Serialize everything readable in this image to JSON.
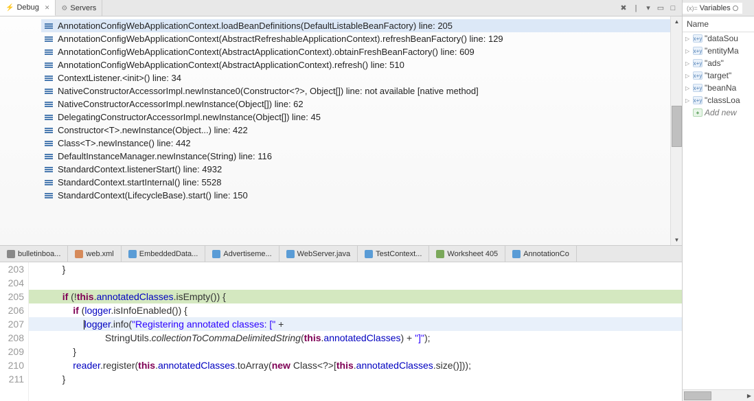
{
  "debugView": {
    "tabs": [
      {
        "label": "Debug",
        "active": true,
        "iconClass": "tab-icon-debug"
      },
      {
        "label": "Servers",
        "active": false,
        "iconClass": "tab-icon-servers"
      }
    ],
    "stack": [
      {
        "label": "AnnotationConfigWebApplicationContext.loadBeanDefinitions(DefaultListableBeanFactory) line: 205",
        "selected": true
      },
      {
        "label": "AnnotationConfigWebApplicationContext(AbstractRefreshableApplicationContext).refreshBeanFactory() line: 129",
        "selected": false
      },
      {
        "label": "AnnotationConfigWebApplicationContext(AbstractApplicationContext).obtainFreshBeanFactory() line: 609",
        "selected": false
      },
      {
        "label": "AnnotationConfigWebApplicationContext(AbstractApplicationContext).refresh() line: 510",
        "selected": false
      },
      {
        "label": "ContextListener.<init>() line: 34",
        "selected": false
      },
      {
        "label": "NativeConstructorAccessorImpl.newInstance0(Constructor<?>, Object[]) line: not available [native method]",
        "selected": false
      },
      {
        "label": "NativeConstructorAccessorImpl.newInstance(Object[]) line: 62",
        "selected": false
      },
      {
        "label": "DelegatingConstructorAccessorImpl.newInstance(Object[]) line: 45",
        "selected": false
      },
      {
        "label": "Constructor<T>.newInstance(Object...) line: 422",
        "selected": false
      },
      {
        "label": "Class<T>.newInstance() line: 442",
        "selected": false
      },
      {
        "label": "DefaultInstanceManager.newInstance(String) line: 116",
        "selected": false
      },
      {
        "label": "StandardContext.listenerStart() line: 4932",
        "selected": false
      },
      {
        "label": "StandardContext.startInternal() line: 5528",
        "selected": false
      },
      {
        "label": "StandardContext(LifecycleBase).start() line: 150",
        "selected": false
      }
    ]
  },
  "editorTabs": [
    {
      "label": "bulletinboa...",
      "iconClass": "eicon-generic"
    },
    {
      "label": "web.xml",
      "iconClass": "eicon-xml"
    },
    {
      "label": "EmbeddedData...",
      "iconClass": "eicon-java"
    },
    {
      "label": "Advertiseme...",
      "iconClass": "eicon-java"
    },
    {
      "label": "WebServer.java",
      "iconClass": "eicon-java"
    },
    {
      "label": "TestContext...",
      "iconClass": "eicon-java"
    },
    {
      "label": "Worksheet 405",
      "iconClass": "eicon-sql"
    },
    {
      "label": "AnnotationCo",
      "iconClass": "eicon-java"
    }
  ],
  "gutter": [
    "203",
    "204",
    "205",
    "206",
    "207",
    "208",
    "209",
    "210",
    "211"
  ],
  "code": {
    "l203_close": "            }",
    "l205": {
      "indent": "            ",
      "kw_if": "if",
      "sp": " (!",
      "kw_this": "this",
      "dot": ".",
      "fld": "annotatedClasses",
      "call": ".isEmpty()) {"
    },
    "l206": {
      "indent": "                ",
      "kw_if": "if",
      "sp": " (",
      "fld": "logger",
      "call": ".isInfoEnabled()) {"
    },
    "l207": {
      "indent": "                    ",
      "fld": "logger",
      "dot": ".info(",
      "str": "\"Registering annotated classes: [\"",
      "plus": " +"
    },
    "l208": {
      "indent": "                            StringUtils.",
      "meth": "collectionToCommaDelimitedString",
      "open": "(",
      "kw_this": "this",
      "dot": ".",
      "fld": "annotatedClasses",
      "close": ") + ",
      "str": "\"]\"",
      "end": ");"
    },
    "l209_close": "                }",
    "l210": {
      "indent": "                ",
      "fld1": "reader",
      "call1": ".register(",
      "kw_this": "this",
      "dot": ".",
      "fld2": "annotatedClasses",
      "call2": ".toArray(",
      "kw_new": "new",
      "sp": " Class<?>[",
      "kw_this2": "this",
      "dot2": ".",
      "fld3": "annotatedClasses",
      "call3": ".size()]));"
    },
    "l211_close": "            }"
  },
  "variables": {
    "tab": "Variables",
    "headerName": "Name",
    "items": [
      {
        "name": "\"dataSou",
        "new": false
      },
      {
        "name": "\"entityMa",
        "new": false
      },
      {
        "name": "\"ads\"",
        "new": false
      },
      {
        "name": "\"target\"",
        "new": false
      },
      {
        "name": "\"beanNa",
        "new": false
      },
      {
        "name": "\"classLoa",
        "new": false
      }
    ],
    "addNew": "Add new"
  }
}
